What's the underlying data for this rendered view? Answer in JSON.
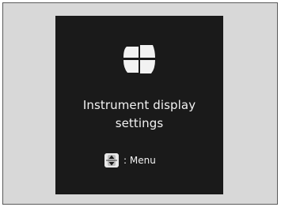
{
  "screen": {
    "title_line1": "Instrument display",
    "title_line2": "settings",
    "hint_label": ": Menu",
    "icons": {
      "section": "instrument-panel-icon",
      "control": "updown-selector-icon"
    }
  },
  "colors": {
    "screen_bg": "#1a1a1a",
    "text": "#f2f2f2",
    "frame_bg": "#d8d8d8"
  }
}
